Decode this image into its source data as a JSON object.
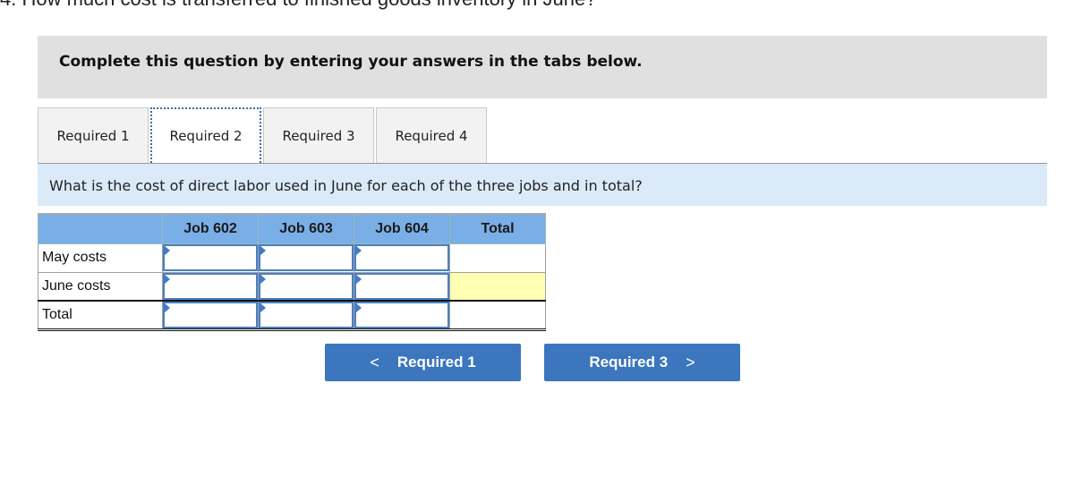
{
  "question_header": "4. How much cost is transferred to finished goods inventory in June?",
  "instruction": "Complete this question by entering your answers in the tabs below.",
  "tabs": [
    {
      "label": "Required 1",
      "active": false
    },
    {
      "label": "Required 2",
      "active": true
    },
    {
      "label": "Required 3",
      "active": false
    },
    {
      "label": "Required 4",
      "active": false
    }
  ],
  "prompt": "What is the cost of direct labor used in June for each of the three jobs and in total?",
  "table": {
    "columns": [
      "",
      "Job 602",
      "Job 603",
      "Job 604",
      "Total"
    ],
    "rows": [
      {
        "label": "May costs",
        "values": [
          "",
          "",
          ""
        ],
        "total": ""
      },
      {
        "label": "June costs",
        "values": [
          "",
          "",
          ""
        ],
        "total": ""
      },
      {
        "label": "Total",
        "values": [
          "",
          "",
          ""
        ],
        "total": ""
      }
    ]
  },
  "nav": {
    "prev_label": "Required 1",
    "next_label": "Required 3",
    "prev_icon": "chevron-left-icon",
    "next_icon": "chevron-right-icon"
  },
  "colors": {
    "header_blue": "#7aaee6",
    "button_blue": "#3b76be",
    "highlight_yellow": "#ffffb3",
    "prompt_bg": "#dbeaf8"
  }
}
